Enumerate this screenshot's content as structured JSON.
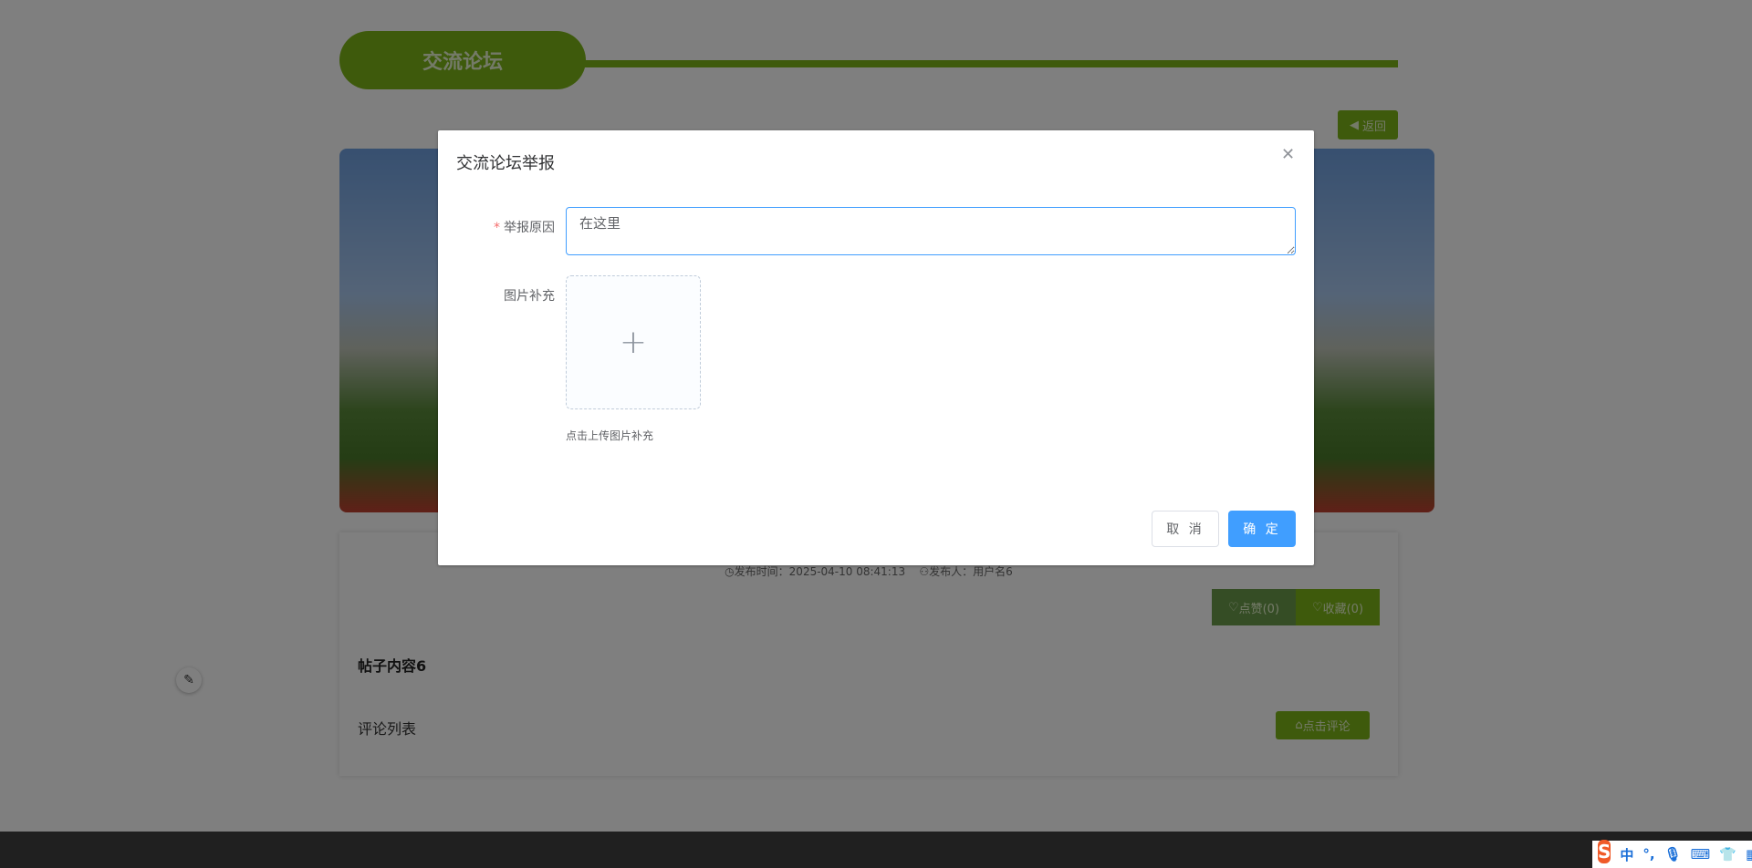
{
  "page": {
    "section_title": "交流论坛",
    "back_label": "返回",
    "meta": {
      "time_label": "发布时间：",
      "time": "2025-04-10 08:41:13",
      "author_label": "发布人：",
      "author": "用户名6"
    },
    "like_label": "点赞(0)",
    "collect_label": "收藏(0)",
    "content": "帖子内容6",
    "comment_list": "评论列表",
    "comment_button": "点击评论"
  },
  "dialog": {
    "title": "交流论坛举报",
    "reason_label": "举报原因",
    "reason_value": "在这里",
    "image_label": "图片补充",
    "upload_tip": "点击上传图片补充",
    "cancel": "取 消",
    "confirm": "确 定"
  },
  "ime": {
    "mode": "中",
    "punct": "°,"
  },
  "colors": {
    "accent": "#7cb518",
    "primary": "#409eff"
  }
}
